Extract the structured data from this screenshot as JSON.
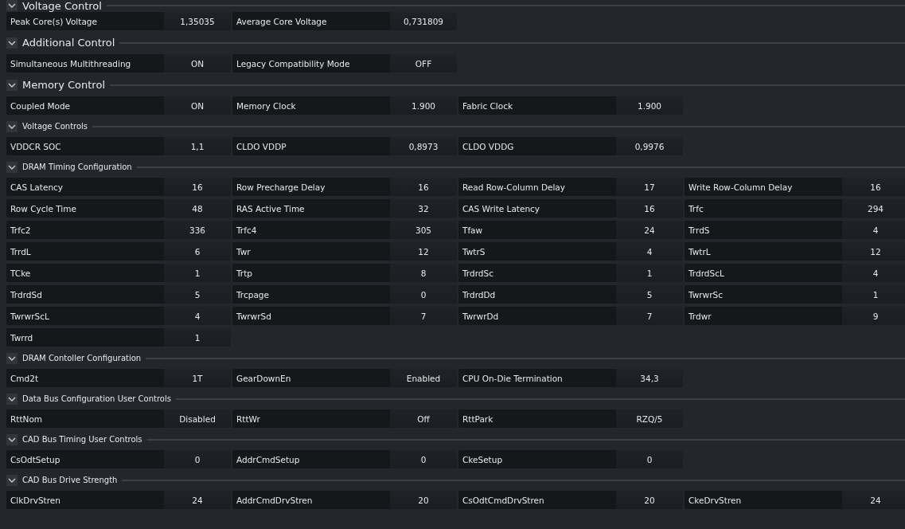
{
  "sections": [
    {
      "title": "Voltage Control",
      "kind": "major",
      "expanded": true,
      "items": [
        {
          "label": "Peak Core(s) Voltage",
          "value": "1,35035"
        },
        {
          "label": "Average Core Voltage",
          "value": "0,731809"
        }
      ]
    },
    {
      "title": "Additional Control",
      "kind": "major",
      "expanded": true,
      "items": [
        {
          "label": "Simultaneous Multithreading",
          "value": "ON"
        },
        {
          "label": "Legacy Compatibility Mode",
          "value": "OFF"
        }
      ]
    },
    {
      "title": "Memory Control",
      "kind": "major",
      "expanded": true,
      "items": [
        {
          "label": "Coupled Mode",
          "value": "ON"
        },
        {
          "label": "Memory Clock",
          "value": "1.900"
        },
        {
          "label": "Fabric Clock",
          "value": "1.900"
        }
      ]
    },
    {
      "title": "Voltage Controls",
      "kind": "minor",
      "expanded": true,
      "items": [
        {
          "label": "VDDCR SOC",
          "value": "1,1"
        },
        {
          "label": "CLDO VDDP",
          "value": "0,8973"
        },
        {
          "label": "CLDO VDDG",
          "value": "0,9976"
        }
      ]
    },
    {
      "title": "DRAM Timing Configuration",
      "kind": "minor",
      "expanded": true,
      "items": [
        {
          "label": "CAS Latency",
          "value": "16"
        },
        {
          "label": "Row Precharge Delay",
          "value": "16"
        },
        {
          "label": "Read Row-Column Delay",
          "value": "17"
        },
        {
          "label": "Write Row-Column Delay",
          "value": "16"
        },
        {
          "label": "Row Cycle Time",
          "value": "48"
        },
        {
          "label": "RAS Active Time",
          "value": "32"
        },
        {
          "label": "CAS Write Latency",
          "value": "16"
        },
        {
          "label": "Trfc",
          "value": "294"
        },
        {
          "label": "Trfc2",
          "value": "336"
        },
        {
          "label": "Trfc4",
          "value": "305"
        },
        {
          "label": "Tfaw",
          "value": "24"
        },
        {
          "label": "TrrdS",
          "value": "4"
        },
        {
          "label": "TrrdL",
          "value": "6"
        },
        {
          "label": "Twr",
          "value": "12"
        },
        {
          "label": "TwtrS",
          "value": "4"
        },
        {
          "label": "TwtrL",
          "value": "12"
        },
        {
          "label": "TCke",
          "value": "1"
        },
        {
          "label": "Trtp",
          "value": "8"
        },
        {
          "label": "TrdrdSc",
          "value": "1"
        },
        {
          "label": "TrdrdScL",
          "value": "4"
        },
        {
          "label": "TrdrdSd",
          "value": "5"
        },
        {
          "label": "Trcpage",
          "value": "0"
        },
        {
          "label": "TrdrdDd",
          "value": "5"
        },
        {
          "label": "TwrwrSc",
          "value": "1"
        },
        {
          "label": "TwrwrScL",
          "value": "4"
        },
        {
          "label": "TwrwrSd",
          "value": "7"
        },
        {
          "label": "TwrwrDd",
          "value": "7"
        },
        {
          "label": "Trdwr",
          "value": "9"
        },
        {
          "label": "Twrrd",
          "value": "1"
        }
      ]
    },
    {
      "title": "DRAM Contoller Configuration",
      "kind": "minor",
      "expanded": true,
      "items": [
        {
          "label": "Cmd2t",
          "value": "1T"
        },
        {
          "label": "GearDownEn",
          "value": "Enabled"
        },
        {
          "label": "CPU On-Die Termination",
          "value": "34,3"
        }
      ]
    },
    {
      "title": "Data Bus Configuration User Controls",
      "kind": "minor",
      "expanded": true,
      "items": [
        {
          "label": "RttNom",
          "value": "Disabled"
        },
        {
          "label": "RttWr",
          "value": "Off"
        },
        {
          "label": "RttPark",
          "value": "RZQ/5"
        }
      ]
    },
    {
      "title": "CAD Bus Timing User Controls",
      "kind": "minor",
      "expanded": true,
      "items": [
        {
          "label": "CsOdtSetup",
          "value": "0"
        },
        {
          "label": "AddrCmdSetup",
          "value": "0"
        },
        {
          "label": "CkeSetup",
          "value": "0"
        }
      ]
    },
    {
      "title": "CAD Bus Drive Strength",
      "kind": "minor",
      "expanded": true,
      "items": [
        {
          "label": "ClkDrvStren",
          "value": "24"
        },
        {
          "label": "AddrCmdDrvStren",
          "value": "20"
        },
        {
          "label": "CsOdtCmdDrvStren",
          "value": "20"
        },
        {
          "label": "CkeDrvStren",
          "value": "24"
        }
      ]
    }
  ]
}
